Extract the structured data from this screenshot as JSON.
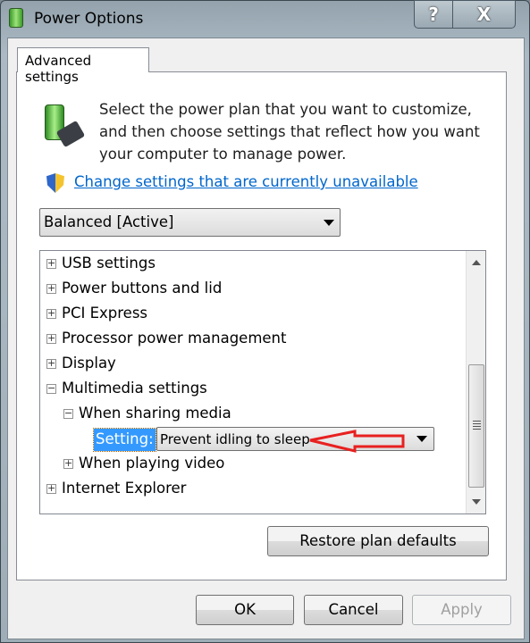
{
  "window": {
    "title": "Power Options",
    "help_label": "?",
    "close_label": "X"
  },
  "tab": {
    "label": "Advanced settings"
  },
  "description": "Select the power plan that you want to customize, and then choose settings that reflect how you want your computer to manage power.",
  "change_link": "Change settings that are currently unavailable",
  "plan_select": {
    "value": "Balanced [Active]"
  },
  "tree": {
    "items": [
      {
        "label": "USB settings",
        "state": "collapsed"
      },
      {
        "label": "Power buttons and lid",
        "state": "collapsed"
      },
      {
        "label": "PCI Express",
        "state": "collapsed"
      },
      {
        "label": "Processor power management",
        "state": "collapsed"
      },
      {
        "label": "Display",
        "state": "collapsed"
      },
      {
        "label": "Multimedia settings",
        "state": "expanded"
      },
      {
        "label": "When sharing media",
        "state": "expanded"
      },
      {
        "label": "When playing video",
        "state": "collapsed"
      },
      {
        "label": "Internet Explorer",
        "state": "collapsed"
      }
    ],
    "setting_label": "Setting:",
    "setting_value": "Prevent idling to sleep"
  },
  "annotation_color": "#e82020",
  "buttons": {
    "restore": "Restore plan defaults",
    "ok": "OK",
    "cancel": "Cancel",
    "apply": "Apply"
  }
}
